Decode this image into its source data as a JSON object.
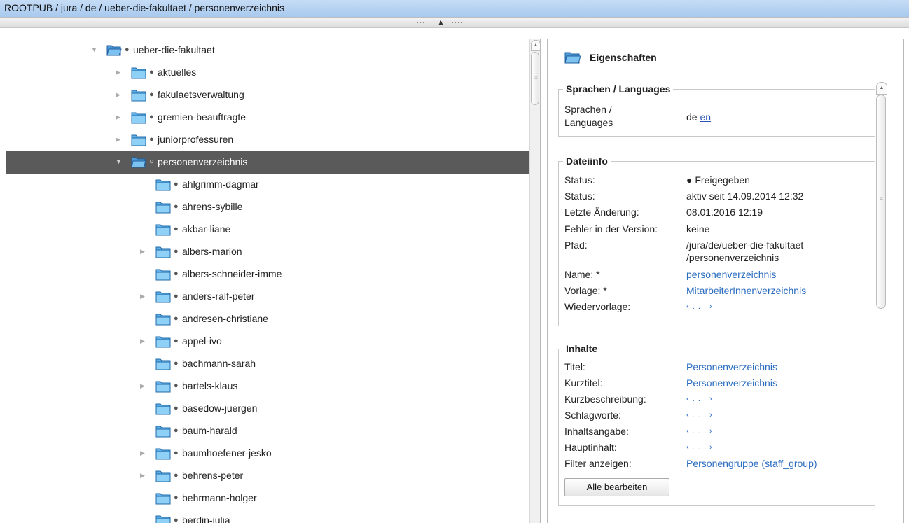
{
  "breadcrumb": "ROOTPUB / jura / de / ueber-die-fakultaet / personenverzeichnis",
  "tree": [
    {
      "label": "ueber-die-fakultaet",
      "expand": "down",
      "indent": 0,
      "marker": "●"
    },
    {
      "label": "aktuelles",
      "expand": "right",
      "indent": 1,
      "marker": "●"
    },
    {
      "label": "fakulaetsverwaltung",
      "expand": "right",
      "indent": 1,
      "marker": "●"
    },
    {
      "label": "gremien-beauftragte",
      "expand": "right",
      "indent": 1,
      "marker": "●"
    },
    {
      "label": "juniorprofessuren",
      "expand": "right",
      "indent": 1,
      "marker": "●"
    },
    {
      "label": "personenverzeichnis",
      "expand": "down",
      "indent": 1,
      "marker": "○",
      "selected": true
    },
    {
      "label": "ahlgrimm-dagmar",
      "expand": "none",
      "indent": 2,
      "marker": "●"
    },
    {
      "label": "ahrens-sybille",
      "expand": "none",
      "indent": 2,
      "marker": "●"
    },
    {
      "label": "akbar-liane",
      "expand": "none",
      "indent": 2,
      "marker": "●"
    },
    {
      "label": "albers-marion",
      "expand": "right",
      "indent": 2,
      "marker": "●"
    },
    {
      "label": "albers-schneider-imme",
      "expand": "none",
      "indent": 2,
      "marker": "●"
    },
    {
      "label": "anders-ralf-peter",
      "expand": "right",
      "indent": 2,
      "marker": "●"
    },
    {
      "label": "andresen-christiane",
      "expand": "none",
      "indent": 2,
      "marker": "●"
    },
    {
      "label": "appel-ivo",
      "expand": "right",
      "indent": 2,
      "marker": "●"
    },
    {
      "label": "bachmann-sarah",
      "expand": "none",
      "indent": 2,
      "marker": "●"
    },
    {
      "label": "bartels-klaus",
      "expand": "right",
      "indent": 2,
      "marker": "●"
    },
    {
      "label": "basedow-juergen",
      "expand": "none",
      "indent": 2,
      "marker": "●"
    },
    {
      "label": "baum-harald",
      "expand": "none",
      "indent": 2,
      "marker": "●"
    },
    {
      "label": "baumhoefener-jesko",
      "expand": "right",
      "indent": 2,
      "marker": "●"
    },
    {
      "label": "behrens-peter",
      "expand": "right",
      "indent": 2,
      "marker": "●"
    },
    {
      "label": "behrmann-holger",
      "expand": "none",
      "indent": 2,
      "marker": "●"
    },
    {
      "label": "berdin-julia",
      "expand": "none",
      "indent": 2,
      "marker": "●"
    }
  ],
  "props": {
    "title": "Eigenschaften",
    "languages": {
      "legend": "Sprachen / Languages",
      "label_line1": "Sprachen /",
      "label_line2": "Languages",
      "current": "de",
      "other_link": "en"
    },
    "dateiinfo": {
      "legend": "Dateiinfo",
      "status_label": "Status:",
      "status_value": "● Freigegeben",
      "status2_label": "Status:",
      "status2_value": "aktiv seit 14.09.2014 12:32",
      "changed_label": "Letzte Änderung:",
      "changed_value": "08.01.2016 12:19",
      "errors_label": "Fehler in der Version:",
      "errors_value": "keine",
      "path_label": "Pfad:",
      "path_line1": "/jura/de/ueber-die-fakultaet",
      "path_line2": "/personenverzeichnis",
      "name_label": "Name: *",
      "name_value": "personenverzeichnis",
      "template_label": "Vorlage: *",
      "template_value": "MitarbeiterInnenverzeichnis",
      "resubmit_label": "Wiedervorlage:",
      "resubmit_value": "‹ . . . ›"
    },
    "inhalte": {
      "legend": "Inhalte",
      "rows": [
        {
          "label": "Titel:",
          "value": "Personenverzeichnis",
          "kind": "link"
        },
        {
          "label": "Kurztitel:",
          "value": "Personenverzeichnis",
          "kind": "link"
        },
        {
          "label": "Kurzbeschreibung:",
          "value": "‹ . . . ›",
          "kind": "ellip"
        },
        {
          "label": "Schlagworte:",
          "value": "‹ . . . ›",
          "kind": "ellip"
        },
        {
          "label": "Inhaltsangabe:",
          "value": "‹ . . . ›",
          "kind": "ellip"
        },
        {
          "label": "Hauptinhalt:",
          "value": "‹ . . . ›",
          "kind": "ellip"
        },
        {
          "label": "Filter anzeigen:",
          "value": "Personengruppe (staff_group)",
          "kind": "link"
        }
      ],
      "edit_all": "Alle bearbeiten"
    }
  },
  "colors": {
    "folder_fill": "#5fb0e8",
    "folder_stroke": "#1f6aa8",
    "selected_row": "#5a5a5a",
    "link": "#2a6cc0"
  }
}
